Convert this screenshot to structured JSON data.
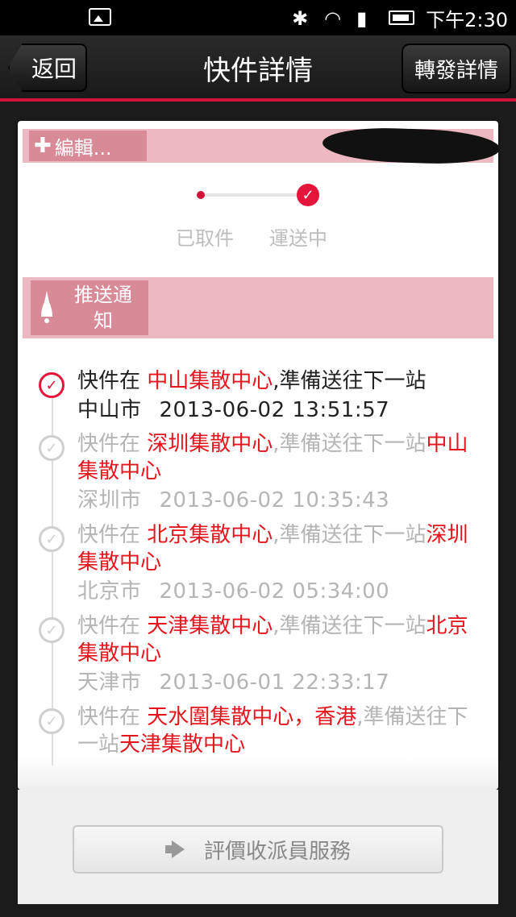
{
  "status_bar": {
    "time": "下午2:30"
  },
  "header": {
    "back_label": "返回",
    "title": "快件詳情",
    "forward_label": "轉發詳情"
  },
  "edit": {
    "label": "編輯..."
  },
  "progress": {
    "stages": [
      "已取件",
      "運送中"
    ],
    "current_stage": 2
  },
  "push": {
    "label_line1": "推送通",
    "label_line2": "知"
  },
  "timeline": [
    {
      "prefix": "快件在 ",
      "hub": "中山集散中心",
      "middle": ",準備送往下一站",
      "next": "",
      "city": "中山市",
      "date": "2013-06-02",
      "time": "13:51:57",
      "active": true
    },
    {
      "prefix": "快件在 ",
      "hub": "深圳集散中心",
      "middle": ",準備送往下一站",
      "next": "中山集散中心",
      "city": "深圳市",
      "date": "2013-06-02",
      "time": "10:35:43",
      "active": false
    },
    {
      "prefix": "快件在 ",
      "hub": "北京集散中心",
      "middle": ",準備送往下一站",
      "next": "深圳集散中心",
      "city": "北京市",
      "date": "2013-06-02",
      "time": "05:34:00",
      "active": false
    },
    {
      "prefix": "快件在 ",
      "hub": "天津集散中心",
      "middle": ",準備送往下一站",
      "next": "北京集散中心",
      "city": "天津市",
      "date": "2013-06-01",
      "time": "22:33:17",
      "active": false
    },
    {
      "prefix": "快件在 ",
      "hub": "天水圍集散中心，香港",
      "middle": ",準備送往下一站",
      "next": "天津集散中心",
      "city": "",
      "date": "",
      "time": "",
      "active": false
    }
  ],
  "rate": {
    "label": "評價收派員服務"
  },
  "colors": {
    "accent": "#e5143a",
    "pink_bar": "#ecb9c2",
    "pink_button": "#d98a97"
  }
}
